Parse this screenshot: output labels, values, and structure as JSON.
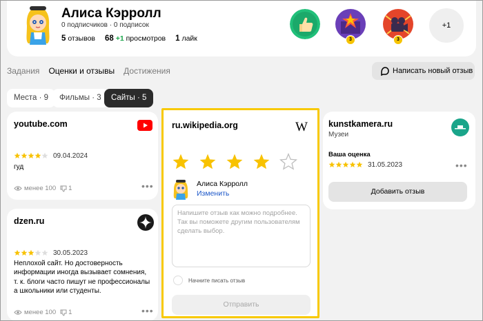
{
  "profile": {
    "name": "Алиса Кэрролл",
    "subscriptions": "0 подписчиков · 0 подписок",
    "reviews_count": "5",
    "reviews_label": "отзывов",
    "views_count": "68",
    "views_delta": "+1",
    "views_label": "просмотров",
    "likes_count": "1",
    "likes_label": "лайк",
    "badges": [
      {
        "name": "thumbs-up-badge"
      },
      {
        "name": "star-badge",
        "count": "3"
      },
      {
        "name": "movie-camera-badge",
        "count": "3"
      }
    ],
    "badges_more": "+1"
  },
  "tabs": [
    {
      "label": "Задания",
      "active": false
    },
    {
      "label": "Оценки и отзывы",
      "active": true
    },
    {
      "label": "Достижения",
      "active": false
    }
  ],
  "write_button": "Написать новый отзыв",
  "filters": [
    {
      "label": "Места · 9",
      "selected": false
    },
    {
      "label": "Фильмы · 3",
      "selected": false
    },
    {
      "label": "Сайты · 5",
      "selected": true
    }
  ],
  "reviews": {
    "youtube": {
      "site": "youtube.com",
      "rating": 4,
      "date": "09.04.2024",
      "text": "гуд",
      "views": "менее 100",
      "likes": "1"
    },
    "dzen": {
      "site": "dzen.ru",
      "rating": 3,
      "date": "30.05.2023",
      "text": "Неплохой сайт. Но достоверность информации иногда вызывает сомнения, т. к. блоги часто пишут не профессионалы а школьники или студенты.",
      "views": "менее 100",
      "likes": "1"
    },
    "wikipedia": {
      "site": "ru.wikipedia.org",
      "logo_letter": "W",
      "rating": 4,
      "author": "Алиса Кэрролл",
      "edit_link": "Изменить",
      "placeholder": "Напишите отзыв как можно подробнее. Так вы поможете другим пользователям сделать выбор.",
      "hint": "Начните писать отзыв",
      "submit": "Отправить"
    },
    "kunstkamera": {
      "site": "kunstkamera.ru",
      "category": "Музеи",
      "your_rating_label": "Ваша оценка",
      "rating": 5,
      "date": "31.05.2023",
      "add_button": "Добавить отзыв"
    }
  },
  "colors": {
    "star": "#f8c200",
    "highlight": "#f8c900",
    "green": "#1aa54a",
    "youtube_red": "#ff0000",
    "kunst_teal": "#1aa58a"
  }
}
